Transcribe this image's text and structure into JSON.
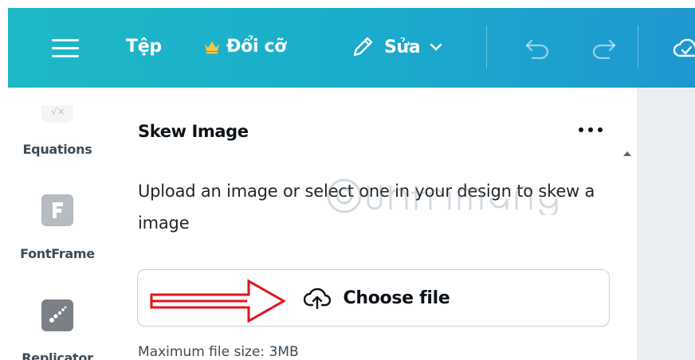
{
  "toolbar": {
    "file_label": "Tệp",
    "resize_label": "Đổi cỡ",
    "edit_label": "Sửa"
  },
  "sidebar": {
    "items": [
      {
        "label": "Equations",
        "icon": "equations-icon"
      },
      {
        "label": "FontFrame",
        "icon": "fontframe-icon"
      },
      {
        "label": "Replicator",
        "icon": "replicator-icon"
      }
    ]
  },
  "panel": {
    "title": "Skew Image",
    "description": "Upload an image or select one in your design to skew a image",
    "choose_file_label": "Choose file",
    "max_file_size": "Maximum file size: 3MB"
  },
  "colors": {
    "topbar_start": "#1fb8c6",
    "topbar_end": "#1e98d0",
    "annotation_arrow": "#e0141c"
  }
}
